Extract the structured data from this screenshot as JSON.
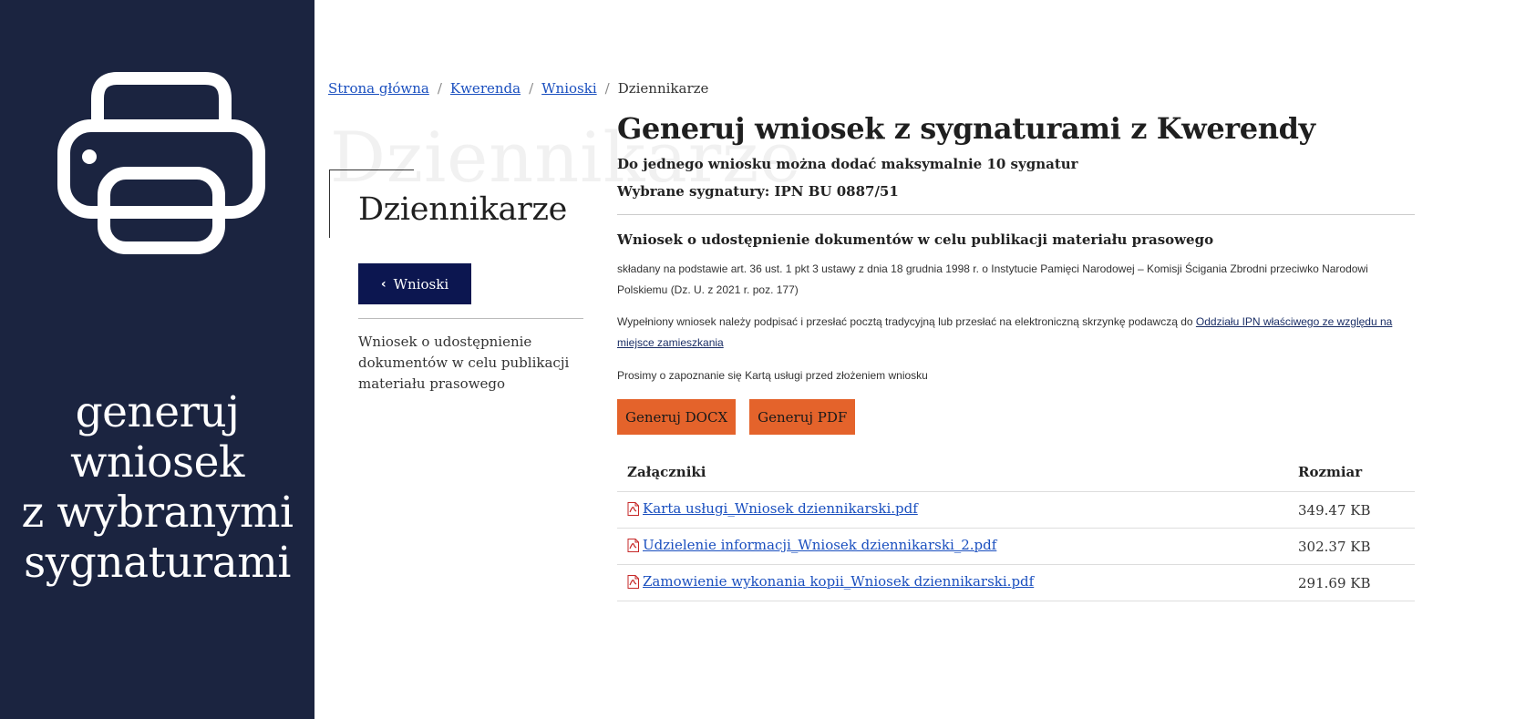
{
  "sidebar": {
    "title_lines": [
      "generuj",
      "wniosek",
      "z wybranymi",
      "sygnaturami"
    ],
    "icon": "printer-icon"
  },
  "breadcrumb": {
    "items": [
      "Strona główna",
      "Kwerenda",
      "Wnioski"
    ],
    "current": "Dziennikarze"
  },
  "category": {
    "watermark": "Dziennikarze",
    "title": "Dziennikarze",
    "back_label": "Wnioski",
    "link_text": "Wniosek o udostępnienie dokumentów w celu publikacji materiału prasowego"
  },
  "main": {
    "title": "Generuj wniosek z sygnaturami z Kwerendy",
    "limit_note": "Do jednego wniosku można dodać maksymalnie 10 sygnatur",
    "selected_signatures": "Wybrane sygnatury: IPN BU 0887/51",
    "form_title": "Wniosek o udostępnienie dokumentów w celu publikacji materiału prasowego",
    "legal_basis": "składany na podstawie art. 36 ust. 1 pkt 3 ustawy z dnia 18 grudnia 1998 r. o Instytucie Pamięci Narodowej – Komisji Ścigania Zbrodni przeciwko Narodowi Polskiemu (Dz. U. z 2021 r. poz. 177)",
    "instructions_prefix": "Wypełniony wniosek należy podpisać i przesłać pocztą tradycyjną lub przesłać na elektroniczną skrzynkę podawczą do ",
    "instructions_link": "Oddziału IPN właściwego ze względu na miejsce zamieszkania",
    "notice": "Prosimy o zapoznanie się Kartą usługi przed złożeniem wniosku",
    "btn_docx": "Generuj DOCX",
    "btn_pdf": "Generuj PDF"
  },
  "attachments": {
    "headers": [
      "Załączniki",
      "Rozmiar"
    ],
    "rows": [
      {
        "name": "Karta usługi_Wniosek dziennikarski.pdf",
        "size": "349.47 KB"
      },
      {
        "name": "Udzielenie informacji_Wniosek dziennikarski_2.pdf",
        "size": "302.37 KB"
      },
      {
        "name": "Zamowienie wykonania kopii_Wniosek dziennikarski.pdf",
        "size": "291.69 KB"
      }
    ]
  },
  "colors": {
    "sidebar_bg": "#1b2440",
    "back_button_bg": "#0c1650",
    "generate_button_bg": "#e4632b",
    "link": "#1a4fbf"
  }
}
